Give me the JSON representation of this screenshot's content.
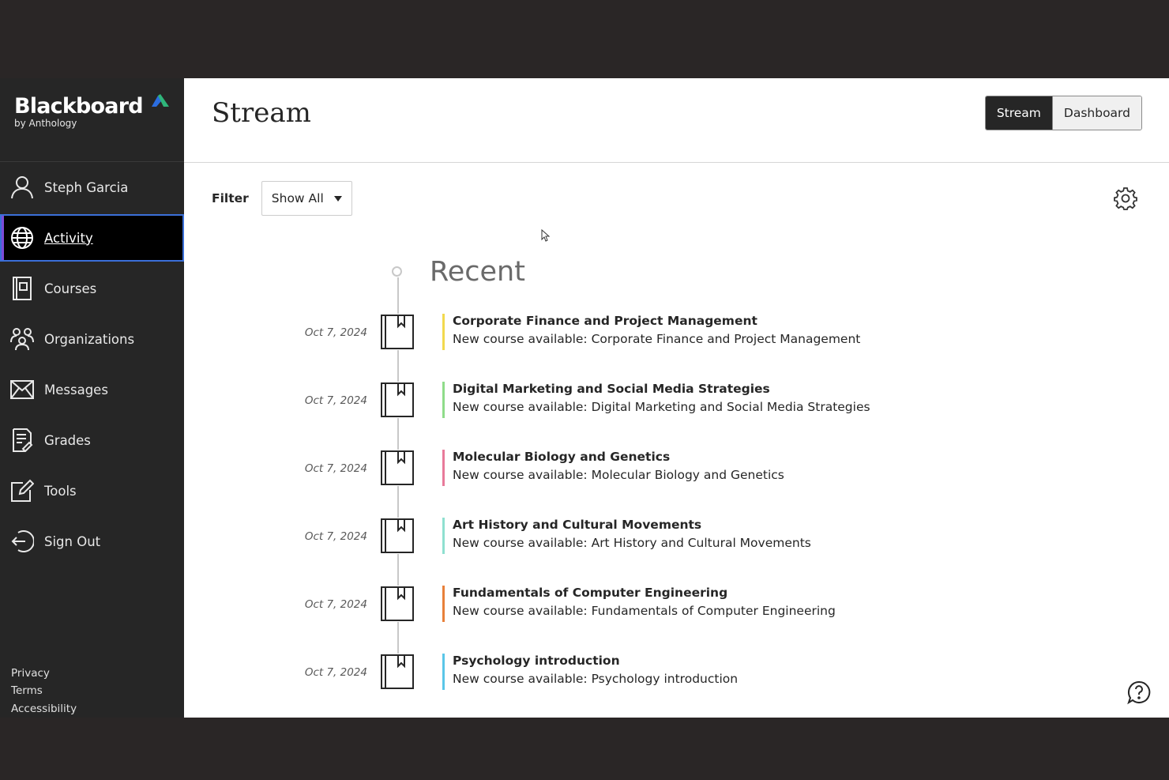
{
  "brand": {
    "name": "Blackboard",
    "sub": "by Anthology",
    "mark_color_blue": "#2b6de0",
    "mark_color_green": "#2fb57a"
  },
  "sidebar": {
    "items": [
      {
        "label": "Steph Garcia",
        "icon": "user-icon"
      },
      {
        "label": "Activity",
        "icon": "globe-icon",
        "active": true
      },
      {
        "label": "Courses",
        "icon": "courses-icon"
      },
      {
        "label": "Organizations",
        "icon": "organizations-icon"
      },
      {
        "label": "Messages",
        "icon": "envelope-icon"
      },
      {
        "label": "Grades",
        "icon": "grades-icon"
      },
      {
        "label": "Tools",
        "icon": "tools-icon"
      },
      {
        "label": "Sign Out",
        "icon": "sign-out-icon"
      }
    ],
    "footer": {
      "privacy": "Privacy",
      "terms": "Terms",
      "accessibility": "Accessibility"
    },
    "active_outline_color": "#3b6fd8"
  },
  "header": {
    "title": "Stream",
    "toggle": {
      "stream": "Stream",
      "dashboard": "Dashboard"
    }
  },
  "filter": {
    "label": "Filter",
    "selected": "Show All"
  },
  "timeline": {
    "section": "Recent",
    "entries": [
      {
        "date": "Oct 7, 2024",
        "title": "Corporate Finance and Project Management",
        "desc": "New course available: Corporate Finance and Project Management",
        "color": "#f2d94e"
      },
      {
        "date": "Oct 7, 2024",
        "title": "Digital Marketing and Social Media Strategies",
        "desc": "New course available: Digital Marketing and Social Media Strategies",
        "color": "#8fdc8a"
      },
      {
        "date": "Oct 7, 2024",
        "title": "Molecular Biology and Genetics",
        "desc": "New course available: Molecular Biology and Genetics",
        "color": "#e87a9a"
      },
      {
        "date": "Oct 7, 2024",
        "title": "Art History and Cultural Movements",
        "desc": "New course available: Art History and Cultural Movements",
        "color": "#8fe0d0"
      },
      {
        "date": "Oct 7, 2024",
        "title": "Fundamentals of Computer Engineering",
        "desc": "New course available: Fundamentals of Computer Engineering",
        "color": "#e8803a"
      },
      {
        "date": "Oct 7, 2024",
        "title": "Psychology introduction",
        "desc": "New course available: Psychology introduction",
        "color": "#5ac6e8"
      }
    ]
  }
}
